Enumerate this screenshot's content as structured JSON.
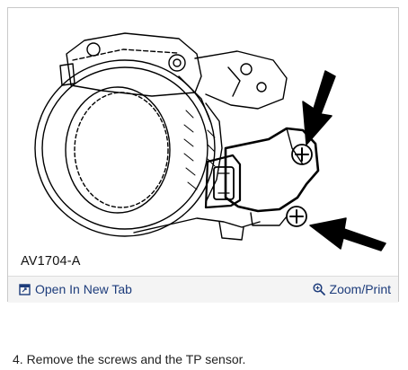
{
  "figure": {
    "caption": "AV1704-A",
    "icons": {
      "open": "open-new-tab-icon",
      "zoom": "magnifier-icon"
    }
  },
  "toolbar": {
    "open_label": "Open In New Tab",
    "zoom_label": "Zoom/Print"
  },
  "step": {
    "text": "4. Remove the screws and the TP sensor."
  },
  "colors": {
    "link": "#1d3c7b",
    "toolbar_bg": "#f4f4f4",
    "border": "#c9c9c9"
  }
}
